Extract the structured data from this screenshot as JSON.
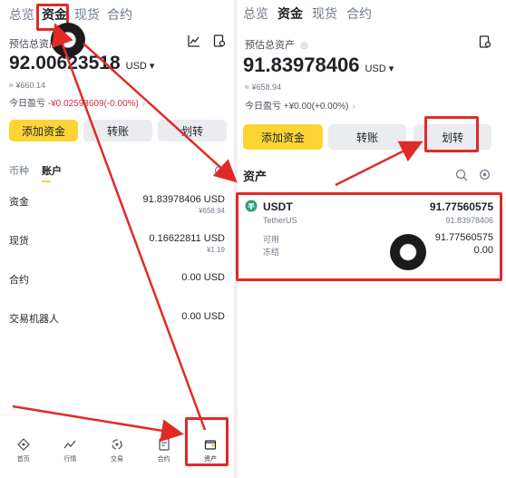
{
  "top_tabs": [
    "总览",
    "资金",
    "现货",
    "合约"
  ],
  "left": {
    "est_label": "预估总资产",
    "balance": "92.00623518",
    "unit": "USD",
    "fiat": "≈ ¥660.14",
    "pnl_label": "今日盈亏",
    "pnl_value": "-¥0.02593609(-0.00%)",
    "buttons": [
      "添加资金",
      "转账",
      "划转"
    ],
    "subtabs": [
      "币种",
      "账户"
    ],
    "accounts": [
      {
        "name": "资金",
        "value": "91.83978406 USD",
        "sub": "¥658.94"
      },
      {
        "name": "现货",
        "value": "0.16622811 USD",
        "sub": "¥1.19"
      },
      {
        "name": "合约",
        "value": "0.00 USD",
        "sub": ""
      },
      {
        "name": "交易机器人",
        "value": "0.00 USD",
        "sub": ""
      }
    ],
    "nav": [
      "首页",
      "行情",
      "交易",
      "合约",
      "资产"
    ]
  },
  "right": {
    "est_label": "预估总资产",
    "balance": "91.83978406",
    "unit": "USD",
    "fiat": "≈ ¥658.94",
    "pnl_label": "今日盈亏",
    "pnl_value": "+¥0.00(+0.00%)",
    "buttons": [
      "添加资金",
      "转账",
      "划转"
    ],
    "section_title": "资产",
    "coin": {
      "symbol": "USDT",
      "name": "TetherUS",
      "total": "91.77560575",
      "total_fiat": "91.83978406",
      "available_label": "可用",
      "available": "91.77560575",
      "frozen_label": "冻结",
      "frozen": "0.00"
    }
  },
  "colors": {
    "accent": "#fcd535",
    "negative": "#cf304a",
    "annotation": "#e02a28",
    "usdt": "#26a17b"
  }
}
